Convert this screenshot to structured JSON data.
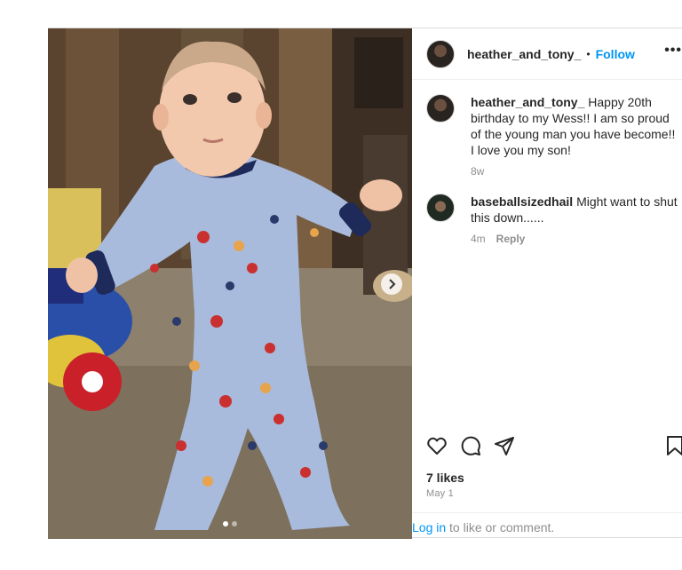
{
  "post": {
    "username": "heather_and_tony_",
    "separator": "•",
    "follow_label": "Follow",
    "more_label": "•••",
    "carousel": {
      "slide_count": 2,
      "active_slide": 1
    }
  },
  "comments": [
    {
      "username": "heather_and_tony_",
      "text": "Happy 20th birthday to my Wess!! I am so proud of the young man you have become!! I love you my son!",
      "time": "8w",
      "reply_label": ""
    },
    {
      "username": "baseballsizedhail",
      "text": "Might want to shut this down......",
      "time": "4m",
      "reply_label": "Reply"
    }
  ],
  "engagement": {
    "likes": "7 likes",
    "date": "May 1"
  },
  "login_prompt": {
    "link": "Log in",
    "rest": " to like or comment."
  },
  "icons": {
    "like": "heart-icon",
    "comment": "comment-icon",
    "share": "send-icon",
    "save": "bookmark-icon",
    "next": "chevron-right-icon"
  },
  "colors": {
    "link_blue": "#0095f6",
    "muted_text": "#8e8e8e",
    "text": "#262626",
    "divider": "#dbdbdb"
  }
}
